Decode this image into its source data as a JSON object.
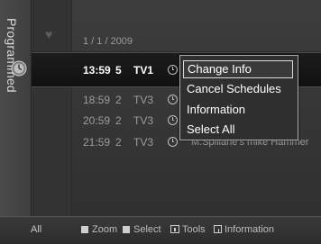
{
  "sidebar": {
    "label": "Programmed"
  },
  "date": "1 / 1 / 2009",
  "schedules": [
    {
      "time": "13:59",
      "channel_num": "5",
      "channel": "TV1",
      "title": "",
      "selected": true
    },
    {
      "time": "18:59",
      "channel_num": "2",
      "channel": "TV3",
      "title": "",
      "selected": false
    },
    {
      "time": "20:59",
      "channel_num": "2",
      "channel": "TV3",
      "title": "",
      "selected": false
    },
    {
      "time": "21:59",
      "channel_num": "2",
      "channel": "TV3",
      "title": "M.Spillane's mike Hammer",
      "selected": false
    }
  ],
  "menu": {
    "items": [
      {
        "label": "Change Info",
        "active": true
      },
      {
        "label": "Cancel Schedules",
        "active": false
      },
      {
        "label": "Information",
        "active": false
      },
      {
        "label": "Select All",
        "active": false
      }
    ]
  },
  "footer": {
    "all": "All",
    "zoom": "Zoom",
    "select": "Select",
    "tools": "Tools",
    "information": "Information"
  },
  "icons": {
    "favorite": "heart-icon",
    "timer": "clock-icon",
    "tools": "tools-icon",
    "info": "info-icon"
  }
}
